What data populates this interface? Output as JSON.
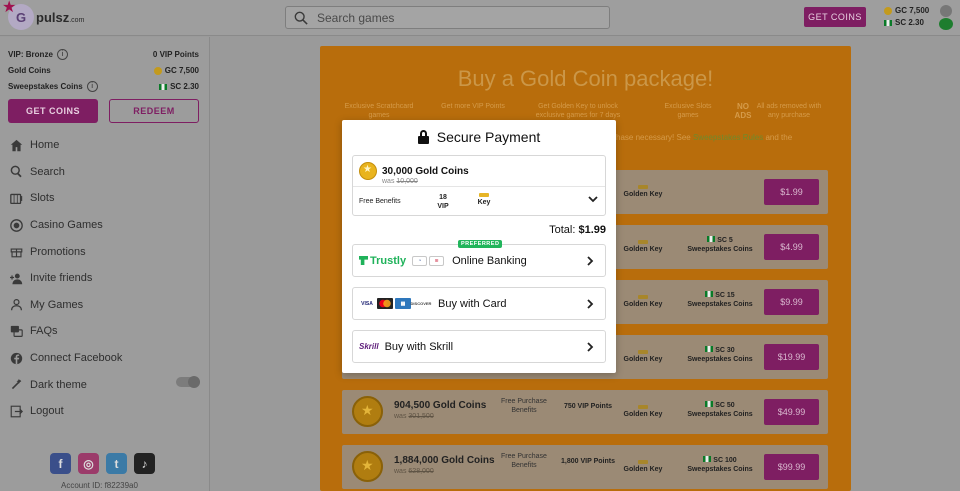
{
  "brand": {
    "logo_letter": "G",
    "name": "pulsz",
    "suffix": ".com"
  },
  "search": {
    "placeholder": "Search games"
  },
  "topbar": {
    "get_coins": "GET COINS",
    "gc_balance": "GC 7,500",
    "sc_balance": "SC 2.30"
  },
  "sidebar": {
    "vip_label": "VIP: Bronze",
    "vip_points": "0 VIP Points",
    "gold_coins_label": "Gold Coins",
    "gold_coins_value": "GC 7,500",
    "sweep_label": "Sweepstakes Coins",
    "sweep_value": "SC 2.30",
    "get_coins": "GET COINS",
    "redeem": "REDEEM",
    "nav": [
      {
        "label": "Home",
        "icon": "home-icon"
      },
      {
        "label": "Search",
        "icon": "search-icon"
      },
      {
        "label": "Slots",
        "icon": "slots-icon"
      },
      {
        "label": "Casino Games",
        "icon": "casino-chip-icon"
      },
      {
        "label": "Promotions",
        "icon": "gift-icon"
      },
      {
        "label": "Invite friends",
        "icon": "add-user-icon"
      },
      {
        "label": "My Games",
        "icon": "user-icon"
      },
      {
        "label": "FAQs",
        "icon": "faq-icon"
      },
      {
        "label": "Connect Facebook",
        "icon": "facebook-icon"
      },
      {
        "label": "Dark theme",
        "icon": "dark-theme-icon"
      },
      {
        "label": "Logout",
        "icon": "logout-icon"
      }
    ],
    "account_id": "Account ID: f82239a0"
  },
  "main": {
    "title": "Buy a Gold Coin package!",
    "features": [
      "Exclusive Scratchcard games",
      "Get more VIP Points",
      "Get Golden Key to unlock exclusive games for 7 days",
      "Exclusive Slots games",
      "All ads removed with any purchase"
    ],
    "no_ads": "NO ADS",
    "note": "hase necessary! See",
    "note_link": "Sweepstakes Rules",
    "note_tail": "and the",
    "packages": [
      {
        "gc": "",
        "was": "",
        "fb": "",
        "vip": "",
        "gk": "Golden Key",
        "sc": "",
        "scsub": "",
        "price": "$1.99"
      },
      {
        "gc": "",
        "was": "",
        "fb": "",
        "vip": "",
        "gk": "Golden Key",
        "sc": "SC 5",
        "scsub": "Sweepstakes Coins",
        "price": "$4.99"
      },
      {
        "gc": "",
        "was": "",
        "fb": "",
        "vip": "",
        "gk": "Golden Key",
        "sc": "SC 15",
        "scsub": "Sweepstakes Coins",
        "price": "$9.99"
      },
      {
        "gc": "",
        "was": "",
        "fb": "",
        "vip": "",
        "gk": "Golden Key",
        "sc": "SC 30",
        "scsub": "Sweepstakes Coins",
        "price": "$19.99"
      },
      {
        "gc": "904,500 Gold Coins",
        "was": "301,500",
        "fb": "Free Purchase Benefits",
        "vip": "750 VIP Points",
        "gk": "Golden Key",
        "sc": "SC 50",
        "scsub": "Sweepstakes Coins",
        "price": "$49.99"
      },
      {
        "gc": "1,884,000 Gold Coins",
        "was": "628,000",
        "fb": "Free Purchase Benefits",
        "vip": "1,800 VIP Points",
        "gk": "Golden Key",
        "sc": "SC 100",
        "scsub": "Sweepstakes Coins",
        "price": "$99.99"
      }
    ]
  },
  "modal": {
    "title": "Secure Payment",
    "gc": "30,000 Gold Coins",
    "was_prefix": "was",
    "was_value": "10,000",
    "free_benefits": "Free Benefits",
    "vip_num": "18",
    "vip_label": "VIP",
    "key_label": "Key",
    "total_label": "Total:",
    "total_value": "$1.99",
    "banking": {
      "brand": "Trustly",
      "badge": "PREFERRED",
      "label": "Online Banking"
    },
    "card": {
      "label": "Buy with Card",
      "brands": [
        "VISA",
        "MC",
        "AMEX",
        "DISCOVER"
      ]
    },
    "skrill": {
      "brand": "Skrill",
      "label": "Buy with Skrill"
    }
  },
  "colors": {
    "accent": "#c0168f",
    "coin": "#e9b41e",
    "trustly": "#1fb25a"
  }
}
